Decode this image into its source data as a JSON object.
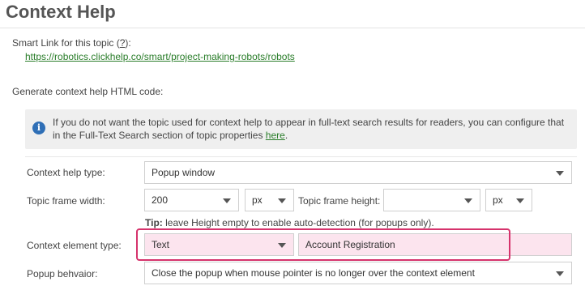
{
  "page": {
    "title": "Context Help"
  },
  "smart_link": {
    "label_prefix": "Smart Link for this topic (",
    "help_link": "?",
    "label_suffix": "):",
    "url": "https://robotics.clickhelp.co/smart/project-making-robots/robots"
  },
  "generate": {
    "label": "Generate context help HTML code:"
  },
  "info": {
    "icon": "info-icon",
    "text_before_link": "If you do not want the topic used for context help to appear in full-text search results for readers, you can configure that in the Full-Text Search section of topic properties ",
    "link_text": "here",
    "text_after_link": "."
  },
  "form": {
    "context_help_type": {
      "label": "Context help type:",
      "value": "Popup window"
    },
    "topic_frame_width": {
      "label": "Topic frame width:",
      "value": "200",
      "unit": "px"
    },
    "topic_frame_height": {
      "label": "Topic frame height:",
      "value": "",
      "unit": "px"
    },
    "tip": {
      "bold": "Tip:",
      "text": " leave Height empty to enable auto-detection (for popups only)."
    },
    "context_element_type": {
      "label": "Context element type:",
      "value": "Text",
      "text_value": "Account Registration"
    },
    "popup_behavior": {
      "label": "Popup behvaior:",
      "value": "Close the popup when mouse pointer is no longer over the context element"
    }
  },
  "colors": {
    "link": "#2a7d2a",
    "info_icon": "#2f6fb6",
    "highlight_border": "#d6336c",
    "highlight_fill": "#fce4ee"
  }
}
